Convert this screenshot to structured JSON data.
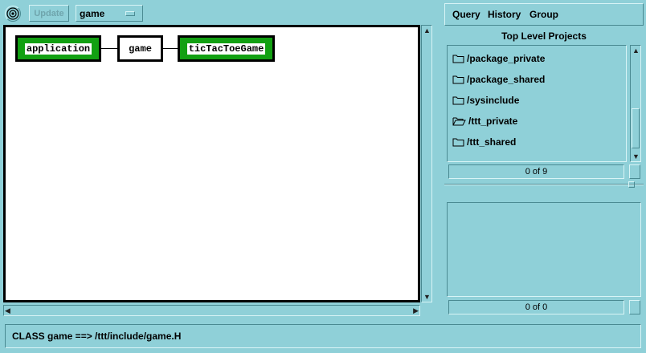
{
  "toolbar": {
    "update_label": "Update",
    "class_value": "game"
  },
  "graph": {
    "nodes": [
      {
        "label": "application",
        "style": "green"
      },
      {
        "label": "game",
        "style": "white"
      },
      {
        "label": "ticTacToeGame",
        "style": "green"
      }
    ]
  },
  "menu": {
    "query": "Query",
    "history": "History",
    "group": "Group"
  },
  "projects": {
    "title": "Top Level Projects",
    "items": [
      {
        "label": "/package_private",
        "icon": "folder-icon"
      },
      {
        "label": "/package_shared",
        "icon": "folder-icon"
      },
      {
        "label": "/sysinclude",
        "icon": "folder-icon"
      },
      {
        "label": "/ttt_private",
        "icon": "folder-open-icon"
      },
      {
        "label": "/ttt_shared",
        "icon": "folder-icon"
      }
    ],
    "count": "0 of 9"
  },
  "lower": {
    "count": "0 of 0"
  },
  "status": {
    "text": "CLASS  game ==> /ttt/include/game.H"
  },
  "colors": {
    "background": "#8fd0d8",
    "node_green": "#12a012"
  }
}
